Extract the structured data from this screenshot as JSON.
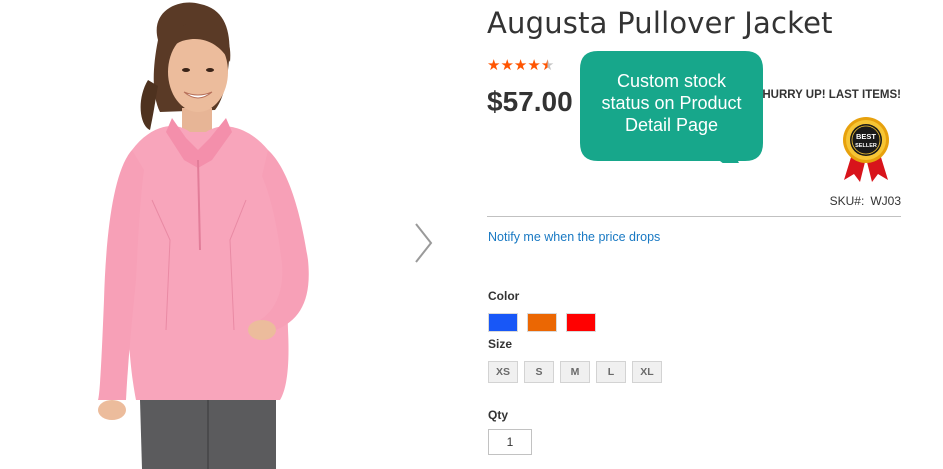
{
  "product": {
    "title": "Augusta Pullover Jacket",
    "rating": 4.5,
    "rating_max": 5,
    "price": "$57.00",
    "stock_status": "HURRY UP! LAST ITEMS!",
    "badge": {
      "line1": "BEST",
      "line2": "SELLER",
      "icon": "best-seller-badge-icon"
    },
    "sku_label": "SKU#:",
    "sku_value": "WJ03",
    "price_alert_link": "Notify me when the price drops"
  },
  "gallery": {
    "next_icon": "chevron-right-icon"
  },
  "options": {
    "color_label": "Color",
    "colors": [
      {
        "name": "Blue",
        "hex": "#1857f7"
      },
      {
        "name": "Orange",
        "hex": "#eb6703"
      },
      {
        "name": "Red",
        "hex": "#ff0101"
      }
    ],
    "size_label": "Size",
    "sizes": [
      "XS",
      "S",
      "M",
      "L",
      "XL"
    ]
  },
  "qty": {
    "label": "Qty",
    "value": "1"
  },
  "callout": {
    "line1": "Custom stock",
    "line2": "status on Product",
    "line3": "Detail Page",
    "color": "#17a78b"
  },
  "colors": {
    "star": "#ff5501",
    "star_empty": "#c4c4c4",
    "link": "#1979c3",
    "text": "#333333"
  }
}
